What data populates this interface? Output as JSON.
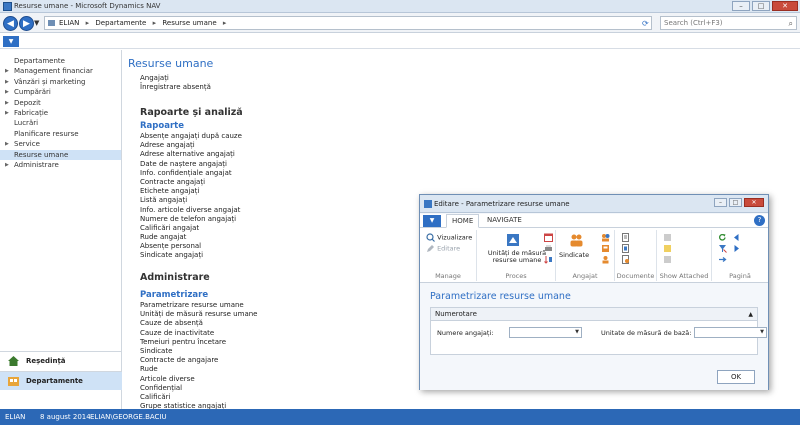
{
  "window": {
    "title": "Resurse umane - Microsoft Dynamics NAV",
    "minimize": "–",
    "maximize": "□",
    "close": "✕"
  },
  "addressbar": {
    "crumbs": [
      "ELIAN",
      "Departamente",
      "Resurse umane"
    ],
    "separator": "▸",
    "search_placeholder": "Search (Ctrl+F3)"
  },
  "sidebar": {
    "items": [
      {
        "label": "Departamente",
        "expandable": false
      },
      {
        "label": "Management financiar",
        "expandable": true
      },
      {
        "label": "Vânzări și marketing",
        "expandable": true
      },
      {
        "label": "Cumpărări",
        "expandable": true
      },
      {
        "label": "Depozit",
        "expandable": true
      },
      {
        "label": "Fabricație",
        "expandable": true
      },
      {
        "label": "Lucrări",
        "expandable": false
      },
      {
        "label": "Planificare resurse",
        "expandable": false
      },
      {
        "label": "Service",
        "expandable": true
      },
      {
        "label": "Resurse umane",
        "expandable": false,
        "selected": true
      },
      {
        "label": "Administrare",
        "expandable": true
      }
    ],
    "footer": [
      {
        "label": "Reședință",
        "selected": false
      },
      {
        "label": "Departamente",
        "selected": true
      }
    ]
  },
  "content": {
    "title": "Resurse umane",
    "top_links": [
      "Angajați",
      "Înregistrare absență"
    ],
    "reports_heading": "Rapoarte și analiză",
    "reports_sub": "Rapoarte",
    "reports": [
      "Absențe angajați după cauze",
      "Adrese angajați",
      "Adrese alternative angajați",
      "Date de naștere angajați",
      "Info. confidențiale angajat",
      "Contracte angajați",
      "Etichete angajați",
      "Listă angajați",
      "Info. articole diverse angajat",
      "Numere de telefon angajați",
      "Calificări angajat",
      "Rude angajat",
      "Absențe personal",
      "Sindicate angajați"
    ],
    "admin_heading": "Administrare",
    "admin_sub": "Parametrizare",
    "admin": [
      "Parametrizare resurse umane",
      "Unități de măsură resurse umane",
      "Cauze de absență",
      "Cauze de inactivitate",
      "Temeiuri pentru încetare",
      "Sindicate",
      "Contracte de angajare",
      "Rude",
      "Articole diverse",
      "Confidențial",
      "Calificări",
      "Grupe statistice angajați"
    ]
  },
  "status": {
    "company": "ELIAN",
    "date": "8 august 2014",
    "user": "ELIAN\\GEORGE.BACIU"
  },
  "dialog": {
    "title": "Editare - Parametrizare resurse umane",
    "tabs": [
      "HOME",
      "NAVIGATE"
    ],
    "help": "?",
    "ribbon": {
      "view": "Vizualizare",
      "edit": "Editare",
      "manage": "Manage",
      "uom": "Unități de măsură resurse umane",
      "process": "Proces",
      "unions": "Sindicate",
      "employee": "Angajat",
      "documents": "Documente",
      "show_attached": "Show Attached",
      "page": "Pagină"
    },
    "heading": "Parametrizare resurse umane",
    "fasttab": "Numerotare",
    "field1_label": "Numere angajați:",
    "field1_value": "",
    "field2_label": "Unitate de măsură de bază:",
    "field2_value": "",
    "ok": "OK"
  },
  "colors": {
    "accent": "#2f6fc4",
    "statusbar": "#2c68b6",
    "selection": "#cfe2f6"
  }
}
